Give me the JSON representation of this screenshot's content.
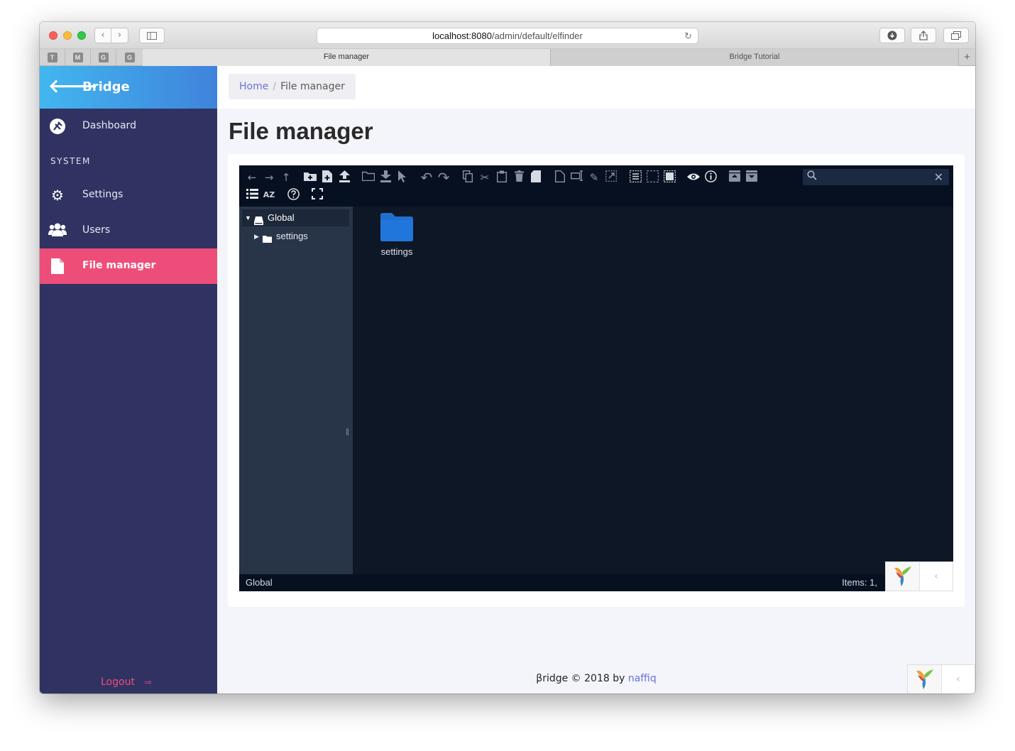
{
  "browser": {
    "url_host": "localhost:8080",
    "url_path": "/admin/default/elfinder",
    "tabs": [
      {
        "label": "File manager"
      },
      {
        "label": "Bridge Tutorial"
      }
    ],
    "favorites": [
      "T",
      "M",
      "G",
      "G"
    ]
  },
  "sidebar": {
    "brand": "Bridge",
    "dashboard": "Dashboard",
    "section": "SYSTEM",
    "items": [
      {
        "label": "Settings"
      },
      {
        "label": "Users"
      },
      {
        "label": "File manager"
      }
    ],
    "logout": "Logout"
  },
  "breadcrumb": {
    "home": "Home",
    "current": "File manager"
  },
  "page": {
    "title": "File manager"
  },
  "elfinder": {
    "search_placeholder": "",
    "tree_root": "Global",
    "tree_children": [
      "settings"
    ],
    "files": [
      {
        "name": "settings",
        "type": "folder"
      }
    ],
    "status_path": "Global",
    "status_items": "Items: 1,"
  },
  "footer": {
    "text": "βridge © 2018 by",
    "author": "naffiq"
  },
  "colors": {
    "sidebar_bg": "#303362",
    "active_item": "#ed4e79",
    "brand_gradient_start": "#42b6ef",
    "brand_gradient_end": "#3f83db",
    "link": "#6a72d6",
    "folder": "#1f6fd1"
  }
}
